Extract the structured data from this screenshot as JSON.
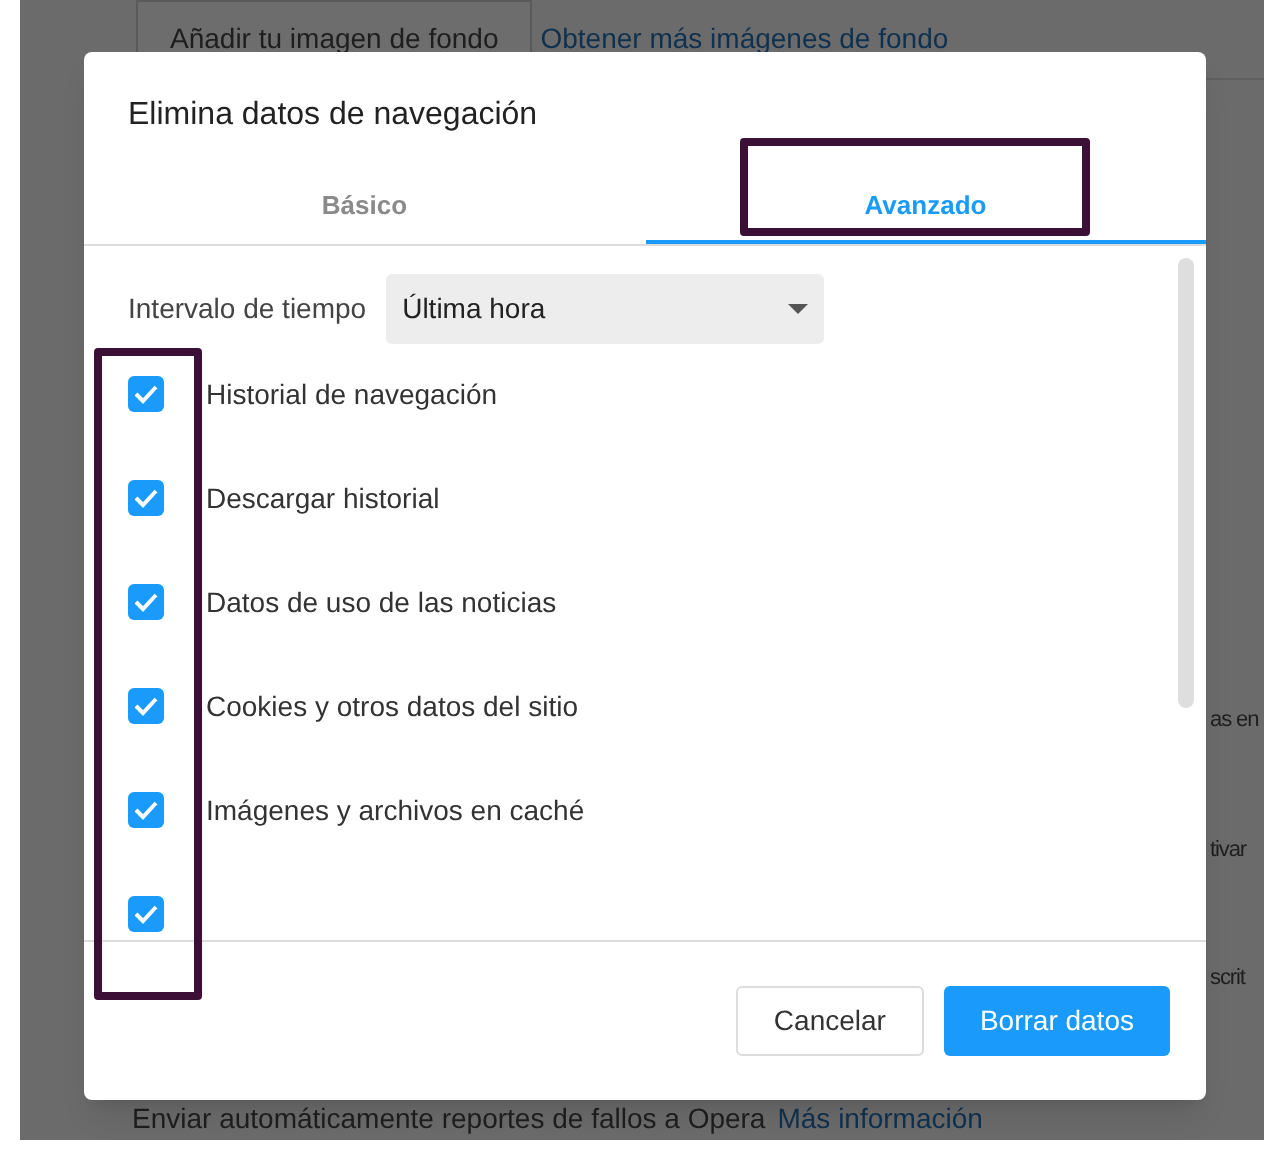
{
  "background_page": {
    "add_background_button": "Añadir tu imagen de fondo",
    "more_backgrounds_link": "Obtener más imágenes de fondo",
    "side_fragments": [
      "as en",
      "tivar",
      "scrit"
    ],
    "crash_reports_text": "Enviar automáticamente reportes de fallos a Opera",
    "more_info_link": "Más información"
  },
  "dialog": {
    "title": "Elimina datos de navegación",
    "tabs": [
      {
        "label": "Básico",
        "selected": false
      },
      {
        "label": "Avanzado",
        "selected": true
      }
    ],
    "time_range": {
      "label": "Intervalo de tiempo",
      "value": "Última hora"
    },
    "items": [
      {
        "label": "Historial de navegación",
        "checked": true
      },
      {
        "label": "Descargar historial",
        "checked": true
      },
      {
        "label": "Datos de uso de las noticias",
        "checked": true
      },
      {
        "label": "Cookies y otros datos del sitio",
        "checked": true
      },
      {
        "label": "Imágenes y archivos en caché",
        "checked": true
      },
      {
        "checked": true
      }
    ],
    "buttons": [
      {
        "label": "Cancelar",
        "kind": "secondary"
      },
      {
        "label": "Borrar datos",
        "kind": "primary"
      }
    ]
  }
}
